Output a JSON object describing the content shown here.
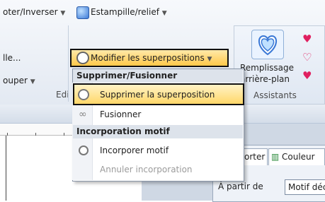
{
  "ribbon": {
    "row1_left": "oter/Inverser",
    "row1_stamp": "Estampille/relief",
    "row2_left": "lle...",
    "modify_overlaps": "Modifier les superpositions",
    "row3_left": "ouper",
    "edit_group_label": "Edi",
    "assistants": {
      "line1": "Remplissage",
      "line2": "arrière-plan",
      "label": "Assistants"
    }
  },
  "menu": {
    "section1": "Supprimer/Fusionner",
    "item_delete": "Supprimer la superposition",
    "item_merge": "Fusionner",
    "section2": "Incorporation motif",
    "item_embed": "Incorporer motif",
    "item_cancel_embed": "Annuler incorporation"
  },
  "panel": {
    "tab1": "orter",
    "tab2": "Couleur",
    "from_label": "À partir de",
    "field_value": "Motif déc"
  },
  "colors": {
    "highlight": "#ffd769",
    "accent_blue": "#3a78d6",
    "heart_red": "#e02060"
  }
}
